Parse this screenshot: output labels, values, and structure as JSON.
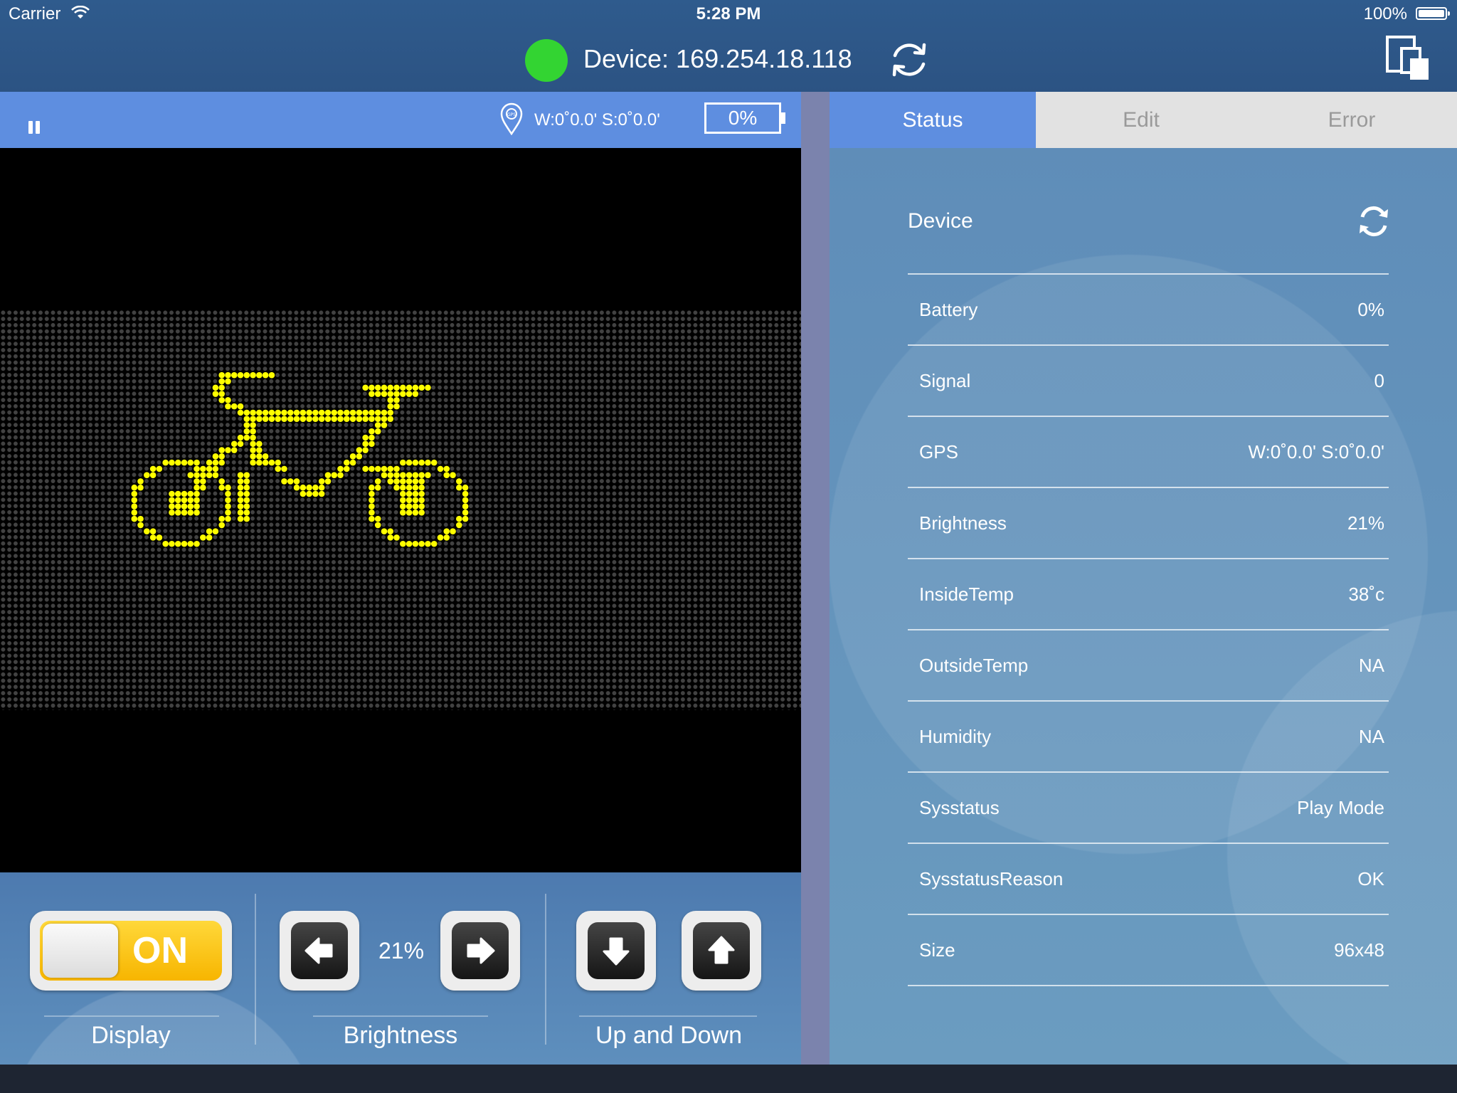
{
  "status_bar": {
    "carrier": "Carrier",
    "time": "5:28 PM",
    "battery": "100%"
  },
  "header": {
    "connection_color": "#33d432",
    "device_title": "Device: 169.254.18.118"
  },
  "preview_bar": {
    "gps": "W:0˚0.0' S:0˚0.0'",
    "battery": "0%"
  },
  "led_panel": {
    "dot_color": "#ffff00",
    "off_color": "#424242",
    "image": "bicycle"
  },
  "controls": {
    "display": {
      "toggle_text": "ON",
      "label": "Display"
    },
    "brightness": {
      "value": "21%",
      "label": "Brightness"
    },
    "updown": {
      "label": "Up and Down"
    }
  },
  "tabs": [
    {
      "label": "Status"
    },
    {
      "label": "Edit"
    },
    {
      "label": "Error"
    }
  ],
  "status_panel": {
    "section_title": "Device",
    "rows": [
      {
        "label": "Battery",
        "value": "0%"
      },
      {
        "label": "Signal",
        "value": "0"
      },
      {
        "label": "GPS",
        "value": "W:0˚0.0' S:0˚0.0'"
      },
      {
        "label": "Brightness",
        "value": "21%"
      },
      {
        "label": "InsideTemp",
        "value": "38˚c"
      },
      {
        "label": "OutsideTemp",
        "value": "NA"
      },
      {
        "label": "Humidity",
        "value": "NA"
      },
      {
        "label": "Sysstatus",
        "value": "Play Mode"
      },
      {
        "label": "SysstatusReason",
        "value": "OK"
      },
      {
        "label": "Size",
        "value": "96x48"
      }
    ]
  }
}
